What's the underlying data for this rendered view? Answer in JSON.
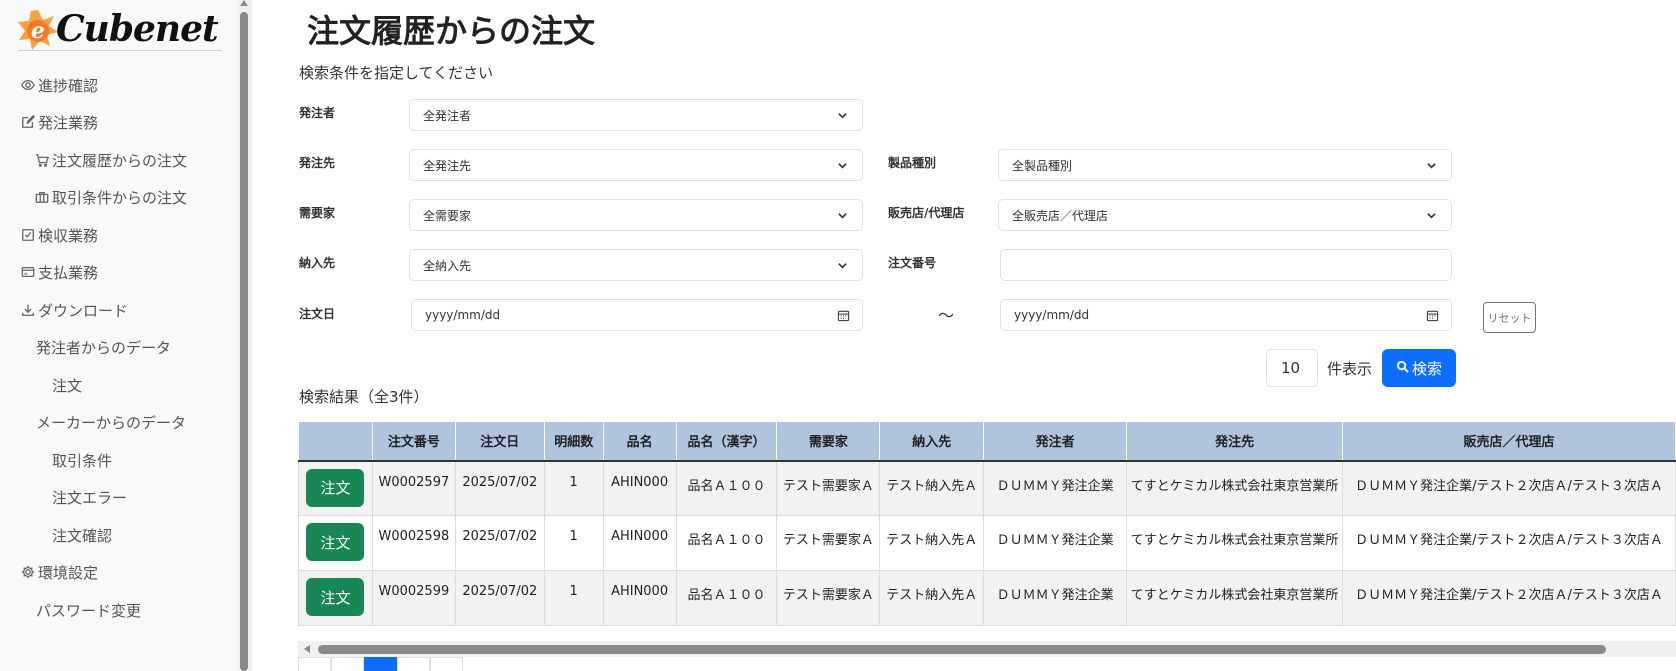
{
  "logo": {
    "text": "Cubenet",
    "mark": "e"
  },
  "sidebar": {
    "items": [
      {
        "label": "進捗確認",
        "icon": "eye-icon"
      },
      {
        "label": "発注業務",
        "icon": "edit-icon"
      },
      {
        "label": "注文履歴からの注文",
        "icon": "cart-icon"
      },
      {
        "label": "取引条件からの注文",
        "icon": "briefcase-icon"
      },
      {
        "label": "検収業務",
        "icon": "check-square-icon"
      },
      {
        "label": "支払業務",
        "icon": "credit-card-icon"
      },
      {
        "label": "ダウンロード",
        "icon": "download-icon"
      },
      {
        "label": "発注者からのデータ"
      },
      {
        "label": "注文"
      },
      {
        "label": "メーカーからのデータ"
      },
      {
        "label": "取引条件"
      },
      {
        "label": "注文エラー"
      },
      {
        "label": "注文確認"
      },
      {
        "label": "環境設定",
        "icon": "gear-icon"
      },
      {
        "label": "パスワード変更"
      }
    ]
  },
  "page": {
    "title": "注文履歴からの注文",
    "subtitle": "検索条件を指定してください"
  },
  "form": {
    "orderer": {
      "label": "発注者",
      "value": "全発注者"
    },
    "supplier": {
      "label": "発注先",
      "value": "全発注先"
    },
    "product_type": {
      "label": "製品種別",
      "value": "全製品種別"
    },
    "customer": {
      "label": "需要家",
      "value": "全需要家"
    },
    "dealer": {
      "label": "販売店/代理店",
      "value": "全販売店／代理店"
    },
    "delivery": {
      "label": "納入先",
      "value": "全納入先"
    },
    "order_no": {
      "label": "注文番号",
      "value": ""
    },
    "order_date": {
      "label": "注文日",
      "from_placeholder": "yyyy/mm/dd",
      "to_placeholder": "yyyy/mm/dd",
      "separator": "〜"
    },
    "reset_label": "リセット",
    "count_value": "10",
    "count_label": "件表示",
    "search_label": "検索"
  },
  "results": {
    "title": "検索結果（全3件）",
    "columns": [
      "",
      "注文番号",
      "注文日",
      "明細数",
      "品名",
      "品名（漢字）",
      "需要家",
      "納入先",
      "発注者",
      "発注先",
      "販売店／代理店"
    ],
    "rows": [
      {
        "action": "注文",
        "order_no": "W0002597",
        "date": "2025/07/02",
        "lines": "1",
        "item": "AHIN000",
        "item_kanji": "品名Ａ１００",
        "customer": "テスト需要家Ａ",
        "delivery": "テスト納入先Ａ",
        "orderer": "ＤＵＭＭＹ発注企業",
        "supplier": "てすとケミカル株式会社東京営業所",
        "dealer": "ＤＵＭＭＹ発注企業/テスト２次店Ａ/テスト３次店Ａ"
      },
      {
        "action": "注文",
        "order_no": "W0002598",
        "date": "2025/07/02",
        "lines": "1",
        "item": "AHIN000",
        "item_kanji": "品名Ａ１００",
        "customer": "テスト需要家Ａ",
        "delivery": "テスト納入先Ａ",
        "orderer": "ＤＵＭＭＹ発注企業",
        "supplier": "てすとケミカル株式会社東京営業所",
        "dealer": "ＤＵＭＭＹ発注企業/テスト２次店Ａ/テスト３次店Ａ"
      },
      {
        "action": "注文",
        "order_no": "W0002599",
        "date": "2025/07/02",
        "lines": "1",
        "item": "AHIN000",
        "item_kanji": "品名Ａ１００",
        "customer": "テスト需要家Ａ",
        "delivery": "テスト納入先Ａ",
        "orderer": "ＤＵＭＭＹ発注企業",
        "supplier": "てすとケミカル株式会社東京営業所",
        "dealer": "ＤＵＭＭＹ発注企業/テスト２次店Ａ/テスト３次店Ａ"
      }
    ]
  },
  "colors": {
    "primary": "#0d6efd",
    "success": "#198754",
    "header_bg": "#b0c4de"
  }
}
